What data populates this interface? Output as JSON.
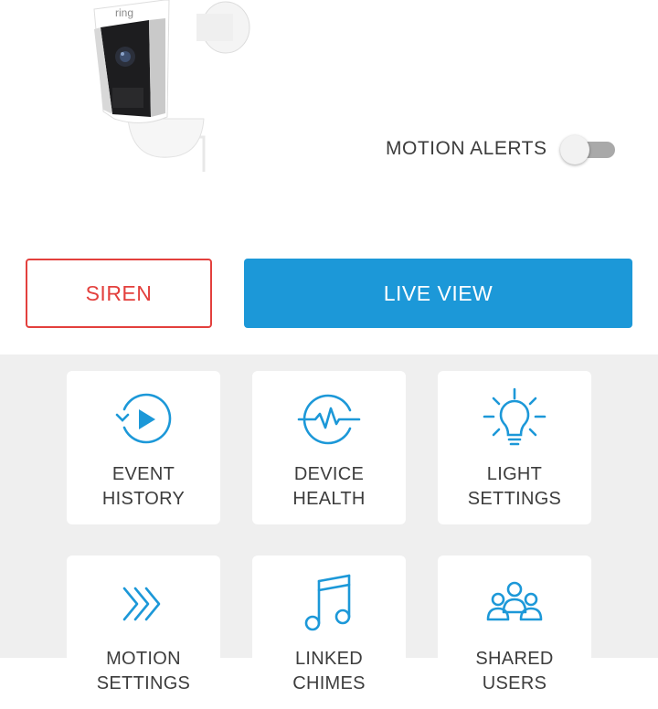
{
  "camera": {
    "brand": "ring"
  },
  "motion_alerts": {
    "label": "MOTION ALERTS",
    "enabled": false
  },
  "actions": {
    "siren_label": "SIREN",
    "live_view_label": "LIVE VIEW"
  },
  "colors": {
    "accent": "#1c98d8",
    "siren": "#e3403d",
    "tile_bg": "#ffffff",
    "grid_bg": "#efefef",
    "text": "#3d3d3d"
  },
  "tiles": [
    {
      "line1": "EVENT",
      "line2": "HISTORY",
      "icon": "event-history-icon"
    },
    {
      "line1": "DEVICE",
      "line2": "HEALTH",
      "icon": "device-health-icon"
    },
    {
      "line1": "LIGHT",
      "line2": "SETTINGS",
      "icon": "light-settings-icon"
    },
    {
      "line1": "MOTION",
      "line2": "SETTINGS",
      "icon": "motion-settings-icon"
    },
    {
      "line1": "LINKED",
      "line2": "CHIMES",
      "icon": "linked-chimes-icon"
    },
    {
      "line1": "SHARED",
      "line2": "USERS",
      "icon": "shared-users-icon"
    }
  ]
}
